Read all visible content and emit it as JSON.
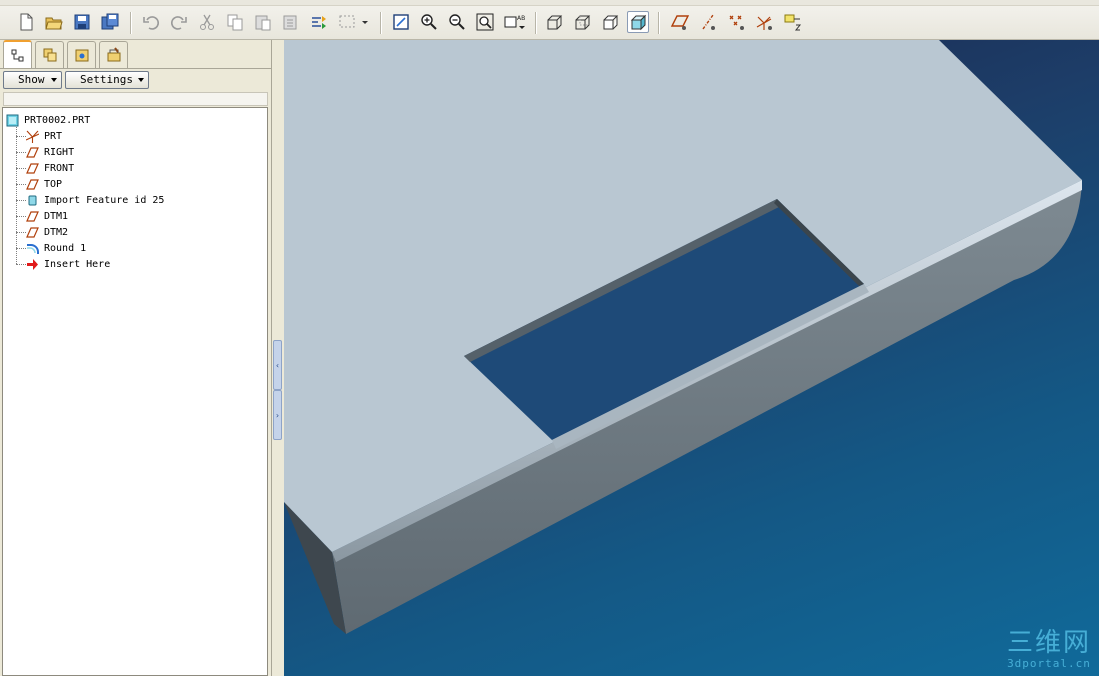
{
  "toolbar": {
    "groups": [
      [
        "new-icon",
        "open-icon",
        "save-icon",
        "save-copy-icon"
      ],
      [
        "undo-icon",
        "redo-icon",
        "cut-icon",
        "copy-icon",
        "paste-icon",
        "paste-special-icon",
        "regenerate-icon",
        "select-box-icon"
      ],
      [
        "repaint-icon",
        "zoom-in-icon",
        "zoom-out-icon",
        "refit-icon",
        "saved-views-icon"
      ],
      [
        "wireframe-icon",
        "hidden-line-icon",
        "no-hidden-icon",
        "shading-icon"
      ],
      [
        "datum-planes-icon",
        "datum-axes-icon",
        "datum-points-icon",
        "coord-sys-icon",
        "annotations-icon"
      ]
    ],
    "active_display_mode": "shading-icon"
  },
  "panel": {
    "tabs": [
      "model-tree-tab",
      "layers-tab",
      "folder-browser-tab",
      "favorites-tab"
    ],
    "show_label": "Show",
    "settings_label": "Settings"
  },
  "tree": {
    "root": "PRT0002.PRT",
    "items": [
      {
        "label": "PRT",
        "icon": "csys-icon"
      },
      {
        "label": "RIGHT",
        "icon": "datum-plane-icon"
      },
      {
        "label": "FRONT",
        "icon": "datum-plane-icon"
      },
      {
        "label": "TOP",
        "icon": "datum-plane-icon"
      },
      {
        "label": "Import Feature id 25",
        "icon": "import-feature-icon"
      },
      {
        "label": "DTM1",
        "icon": "datum-plane-icon"
      },
      {
        "label": "DTM2",
        "icon": "datum-plane-icon"
      },
      {
        "label": "Round 1",
        "icon": "round-icon"
      },
      {
        "label": "Insert Here",
        "icon": "insert-arrow-icon"
      }
    ]
  },
  "watermark": {
    "title": "三维网",
    "url": "3dportal.cn"
  },
  "colors": {
    "viewport_top": "#182246",
    "viewport_bottom": "#106a9a",
    "part_top_face": "#b9c7d2",
    "part_side_face": "#6f7a82"
  }
}
